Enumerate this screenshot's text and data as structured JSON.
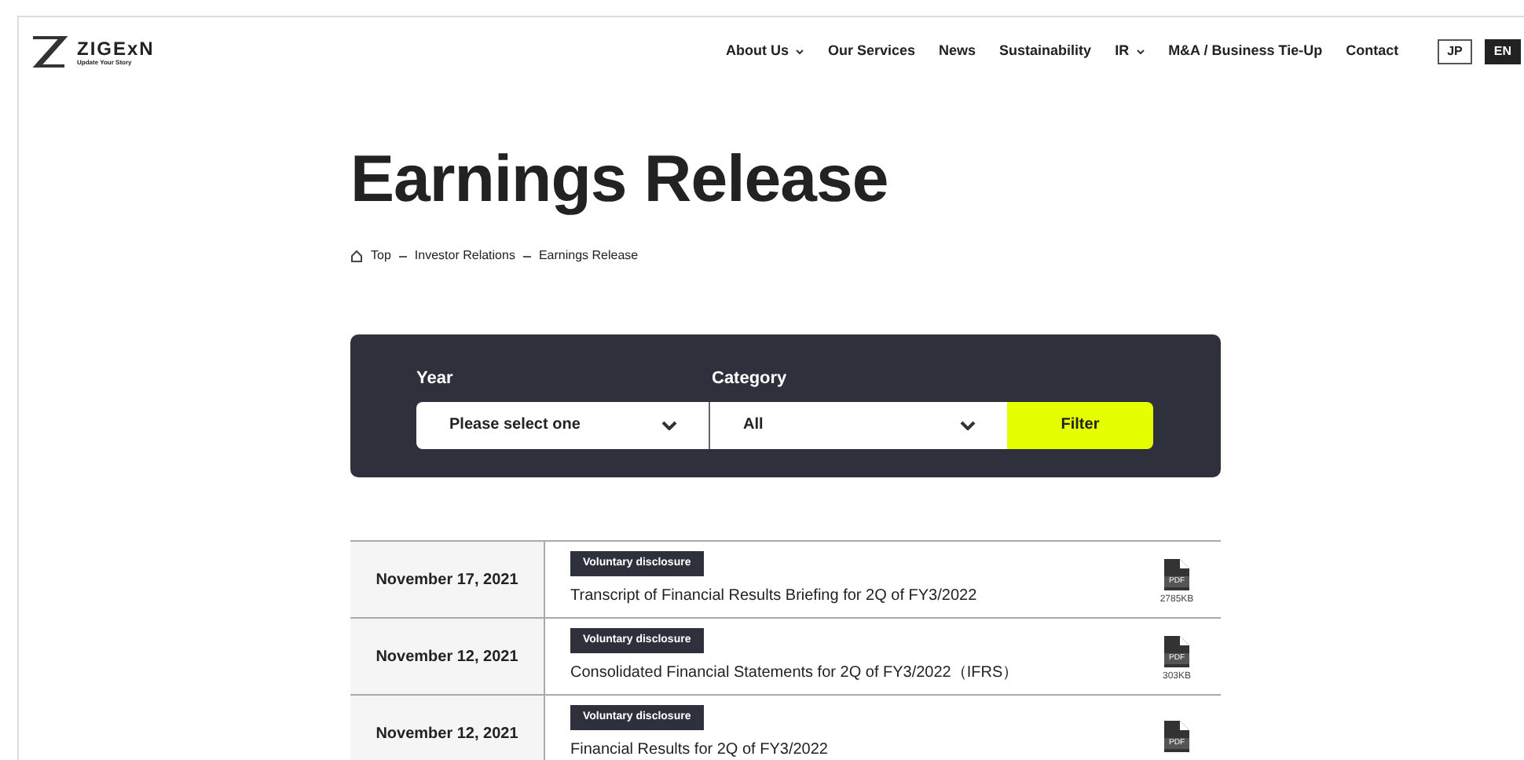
{
  "logo": {
    "name": "ZIGExN",
    "tagline": "Update Your Story"
  },
  "nav": [
    {
      "label": "About Us",
      "dropdown": true
    },
    {
      "label": "Our Services",
      "dropdown": false
    },
    {
      "label": "News",
      "dropdown": false
    },
    {
      "label": "Sustainability",
      "dropdown": false
    },
    {
      "label": "IR",
      "dropdown": true
    },
    {
      "label": "M&A / Business Tie-Up",
      "dropdown": false
    },
    {
      "label": "Contact",
      "dropdown": false
    }
  ],
  "languages": [
    {
      "label": "JP",
      "selected": false
    },
    {
      "label": "EN",
      "selected": true
    }
  ],
  "title": "Earnings Release",
  "breadcrumb": [
    "Top",
    "Investor Relations",
    "Earnings Release"
  ],
  "filter": {
    "year_label": "Year",
    "year_value": "Please select one",
    "category_label": "Category",
    "category_value": "All",
    "button": "Filter"
  },
  "releases": [
    {
      "date": "November 17, 2021",
      "tag": "Voluntary disclosure",
      "title": "Transcript of Financial Results Briefing for 2Q of FY3/2022",
      "file": "PDF",
      "size": "2785KB"
    },
    {
      "date": "November 12, 2021",
      "tag": "Voluntary disclosure",
      "title": "Consolidated Financial Statements for 2Q of FY3/2022（IFRS）",
      "file": "PDF",
      "size": "303KB"
    },
    {
      "date": "November 12, 2021",
      "tag": "Voluntary disclosure",
      "title": "Financial Results for 2Q of FY3/2022",
      "file": "PDF"
    }
  ]
}
